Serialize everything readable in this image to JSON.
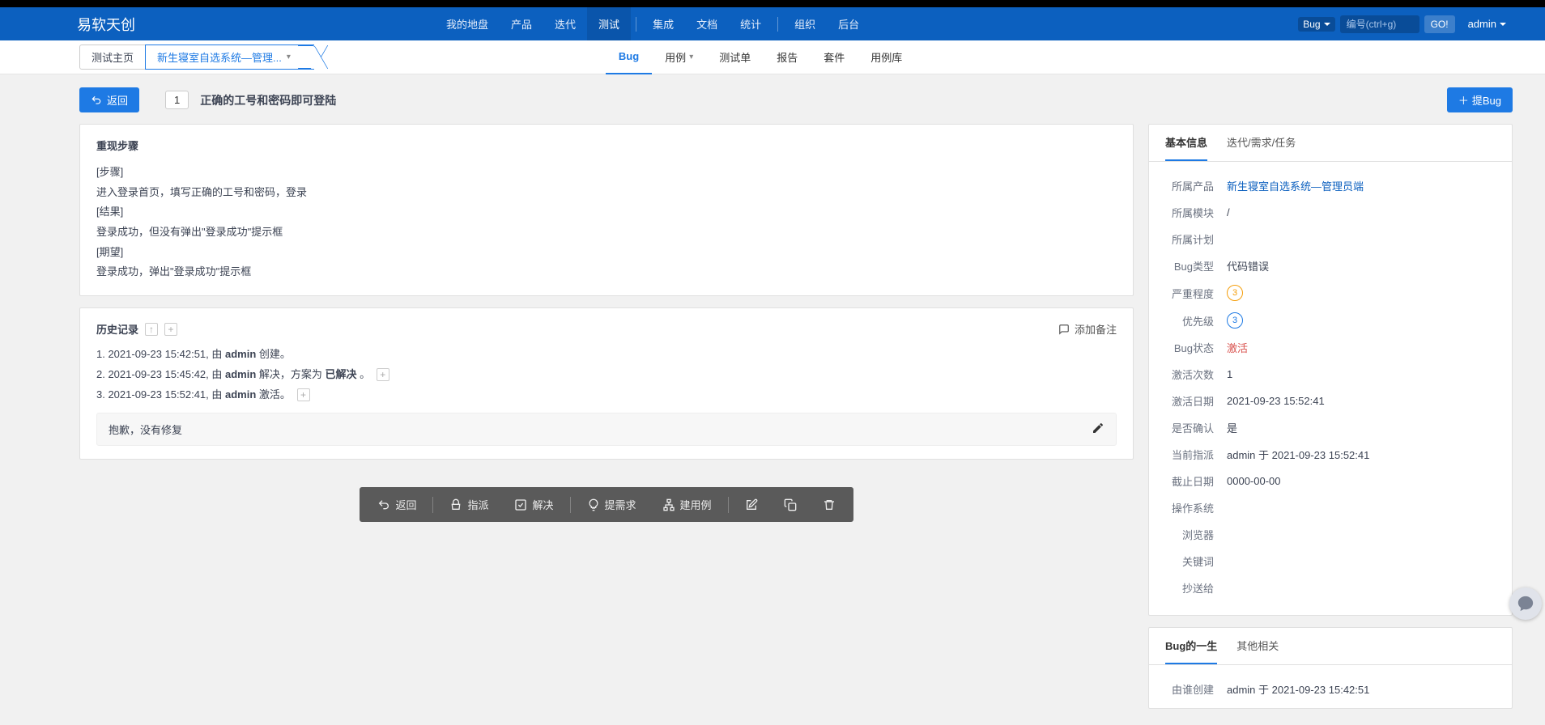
{
  "brand": "易软天创",
  "topnav": {
    "mypanel": "我的地盘",
    "product": "产品",
    "iteration": "迭代",
    "test": "测试",
    "integration": "集成",
    "docs": "文档",
    "stats": "统计",
    "org": "组织",
    "admin": "后台"
  },
  "topright": {
    "bug_selector": "Bug",
    "search_placeholder": "编号(ctrl+g)",
    "go": "GO!",
    "user": "admin"
  },
  "crumb": {
    "home": "测试主页",
    "product": "新生寝室自选系统—管理..."
  },
  "subnav": {
    "bug": "Bug",
    "usecase": "用例",
    "testsheet": "测试单",
    "report": "报告",
    "suite": "套件",
    "caselib": "用例库"
  },
  "page": {
    "back": "返回",
    "id": "1",
    "title": "正确的工号和密码即可登陆",
    "addbug": "提Bug"
  },
  "steps": {
    "title": "重现步骤",
    "l1": "[步骤]",
    "l2": "进入登录首页，填写正确的工号和密码，登录",
    "l3": "[结果]",
    "l4": "登录成功，但没有弹出\"登录成功\"提示框",
    "l5": "[期望]",
    "l6": "登录成功，弹出\"登录成功\"提示框"
  },
  "history": {
    "title": "历史记录",
    "addnote": "添加备注",
    "e1_pre": "1. 2021-09-23 15:42:51, 由 ",
    "e1_user": "admin",
    "e1_post": " 创建。",
    "e2_pre": "2. 2021-09-23 15:45:42, 由 ",
    "e2_user": "admin",
    "e2_mid": " 解决，方案为 ",
    "e2_res": "已解决 ",
    "e2_post": "。",
    "e3_pre": "3. 2021-09-23 15:52:41, 由 ",
    "e3_user": "admin",
    "e3_post": " 激活。",
    "note": "抱歉，没有修复"
  },
  "actions": {
    "back": "返回",
    "assign": "指派",
    "resolve": "解决",
    "tostory": "提需求",
    "tocase": "建用例"
  },
  "info": {
    "tab_basic": "基本信息",
    "tab_iter": "迭代/需求/任务",
    "product_label": "所属产品",
    "product_value": "新生寝室自选系统—管理员端",
    "module_label": "所属模块",
    "module_value": "/",
    "plan_label": "所属计划",
    "plan_value": "",
    "type_label": "Bug类型",
    "type_value": "代码错误",
    "severity_label": "严重程度",
    "severity_value": "3",
    "priority_label": "优先级",
    "priority_value": "3",
    "status_label": "Bug状态",
    "status_value": "激活",
    "actcount_label": "激活次数",
    "actcount_value": "1",
    "actdate_label": "激活日期",
    "actdate_value": "2021-09-23 15:52:41",
    "confirm_label": "是否确认",
    "confirm_value": "是",
    "assigned_label": "当前指派",
    "assigned_value": "admin 于 2021-09-23 15:52:41",
    "deadline_label": "截止日期",
    "deadline_value": "0000-00-00",
    "os_label": "操作系统",
    "browser_label": "浏览器",
    "keyword_label": "关键词",
    "cc_label": "抄送给"
  },
  "life": {
    "tab_life": "Bug的一生",
    "tab_other": "其他相关",
    "creator_label": "由谁创建",
    "creator_value": "admin 于 2021-09-23 15:42:51"
  }
}
